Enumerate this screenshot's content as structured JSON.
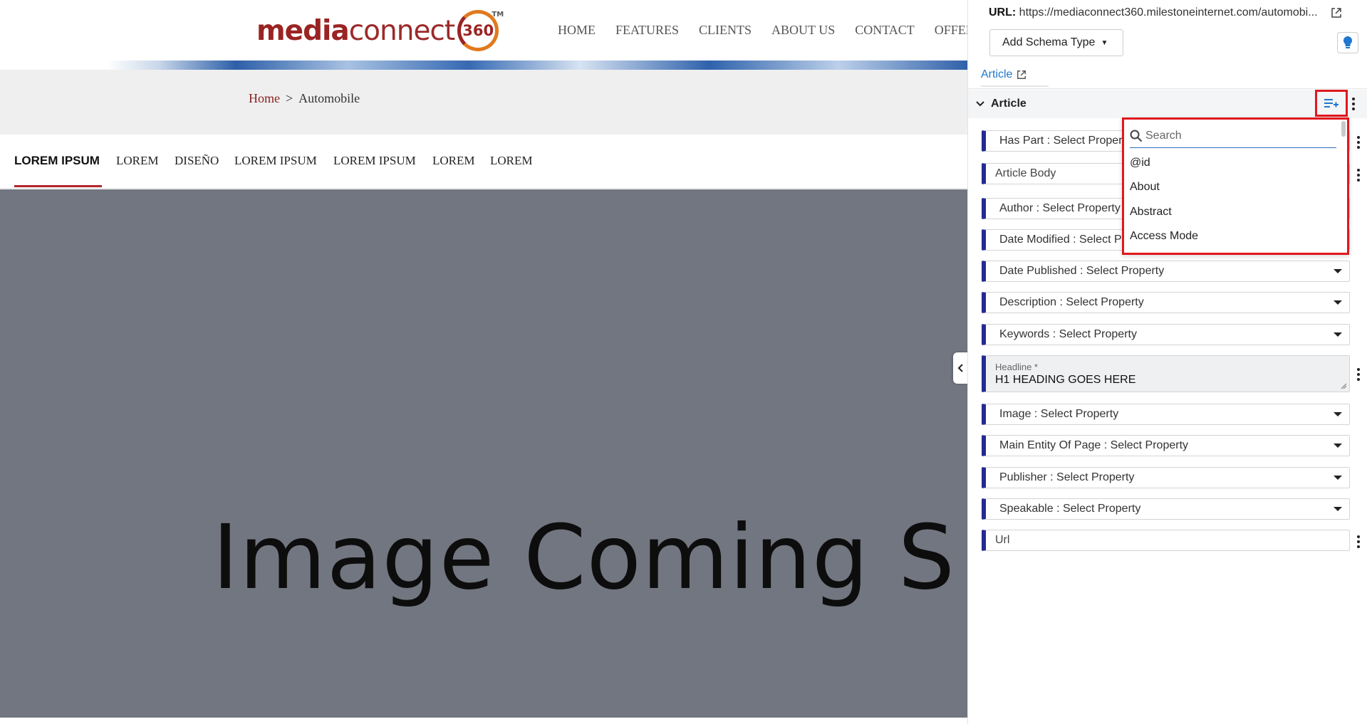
{
  "site": {
    "logo": {
      "word1": "media",
      "word2": "connect",
      "badge": "360",
      "tm": "TM"
    },
    "nav": [
      "HOME",
      "FEATURES",
      "CLIENTS",
      "ABOUT US",
      "CONTACT",
      "OFFER"
    ],
    "breadcrumb": {
      "home": "Home",
      "sep": ">",
      "current": "Automobile"
    },
    "tabs": [
      "LOREM IPSUM",
      "LOREM",
      "DISEÑO",
      "LOREM IPSUM",
      "LOREM IPSUM",
      "LOREM",
      "LOREM"
    ],
    "hero_text": "Image Coming S"
  },
  "panel": {
    "url_label": "URL:",
    "url_value": "https://mediaconnect360.milestoneinternet.com/automobi...",
    "add_schema_label": "Add Schema Type",
    "article_tab": "Article",
    "section_title": "Article",
    "fields": [
      {
        "label": "Has Part : Select Property",
        "type": "select"
      },
      {
        "label": "Article Body",
        "type": "text"
      },
      {
        "label": "Author : Select Property",
        "type": "select"
      },
      {
        "label": "Date Modified : Select Property",
        "type": "select"
      },
      {
        "label": "Date Published : Select Property",
        "type": "select"
      },
      {
        "label": "Description : Select Property",
        "type": "select"
      },
      {
        "label": "Keywords : Select Property",
        "type": "select"
      },
      {
        "label": "Headline *",
        "value": "H1 HEADING GOES HERE",
        "type": "textarea"
      },
      {
        "label": "Image : Select Property",
        "type": "select"
      },
      {
        "label": "Main Entity Of Page : Select Property",
        "type": "select"
      },
      {
        "label": "Publisher : Select Property",
        "type": "select"
      },
      {
        "label": "Speakable : Select Property",
        "type": "select"
      },
      {
        "label": "Url",
        "type": "text"
      }
    ],
    "dropdown": {
      "search_placeholder": "Search",
      "items": [
        "@id",
        "About",
        "Abstract",
        "Access Mode"
      ]
    }
  },
  "colors": {
    "accent_blue": "#252a93",
    "link_blue": "#1f77d0",
    "highlight_red": "#e0181e",
    "brand_red": "#9a2423",
    "hero_gray": "#717680"
  }
}
